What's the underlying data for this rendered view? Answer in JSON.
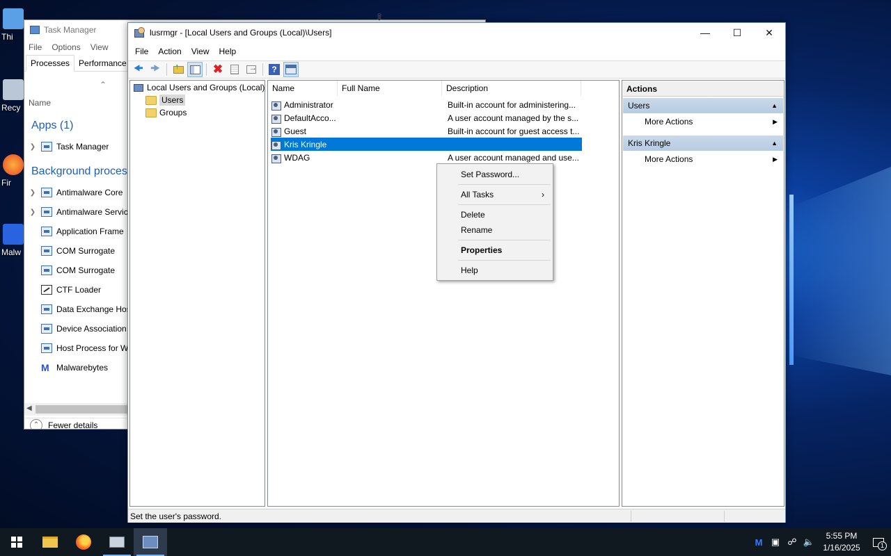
{
  "desktop": {
    "icons": [
      {
        "label": "Thi",
        "icon": "pc-icon"
      },
      {
        "label": "Recy",
        "icon": "recycle-bin-icon"
      },
      {
        "label": "Fir",
        "icon": "firefox-icon"
      },
      {
        "label": "Malw",
        "icon": "malwarebytes-icon"
      }
    ]
  },
  "taskmgr": {
    "title": "Task Manager",
    "menu": [
      "File",
      "Options",
      "View"
    ],
    "tabs": [
      "Processes",
      "Performance"
    ],
    "column_name": "Name",
    "apps_header": "Apps (1)",
    "bg_header": "Background process",
    "apps": [
      {
        "label": "Task Manager"
      }
    ],
    "background": [
      {
        "label": "Antimalware Core",
        "expandable": true
      },
      {
        "label": "Antimalware Servic",
        "expandable": true
      },
      {
        "label": "Application Frame",
        "expandable": false
      },
      {
        "label": "COM Surrogate",
        "expandable": false
      },
      {
        "label": "COM Surrogate",
        "expandable": false
      },
      {
        "label": "CTF Loader",
        "expandable": false
      },
      {
        "label": "Data Exchange Hos",
        "expandable": false
      },
      {
        "label": "Device Association",
        "expandable": false
      },
      {
        "label": "Host Process for W",
        "expandable": false
      },
      {
        "label": "Malwarebytes",
        "expandable": false
      }
    ],
    "fewer_details": "Fewer details"
  },
  "lusrmgr": {
    "title": "lusrmgr - [Local Users and Groups (Local)\\Users]",
    "menu": [
      "File",
      "Action",
      "View",
      "Help"
    ],
    "tree": {
      "root": "Local Users and Groups (Local)",
      "children": [
        "Users",
        "Groups"
      ],
      "selected": "Users"
    },
    "columns": [
      "Name",
      "Full Name",
      "Description"
    ],
    "users": [
      {
        "name": "Administrator",
        "full_name": "",
        "description": "Built-in account for administering..."
      },
      {
        "name": "DefaultAcco...",
        "full_name": "",
        "description": "A user account managed by the s..."
      },
      {
        "name": "Guest",
        "full_name": "",
        "description": "Built-in account for guest access t..."
      },
      {
        "name": "Kris Kringle",
        "full_name": "",
        "description": ""
      },
      {
        "name": "WDAG",
        "full_name": "",
        "description": "A user account managed and use..."
      }
    ],
    "selected_user_index": 3,
    "actions": {
      "header": "Actions",
      "sections": [
        {
          "title": "Users",
          "item": "More Actions"
        },
        {
          "title": "Kris Kringle",
          "item": "More Actions"
        }
      ]
    },
    "status": "Set the user's password."
  },
  "context_menu": {
    "items": [
      "Set Password...",
      "All Tasks",
      "Delete",
      "Rename",
      "Properties",
      "Help"
    ]
  },
  "taskbar": {
    "time": "5:55 PM",
    "date": "1/16/2025",
    "notification_count": "1"
  },
  "colors": {
    "selection": "#0078d7",
    "action_section": "#b7cbe2",
    "taskbar": "#101820"
  }
}
